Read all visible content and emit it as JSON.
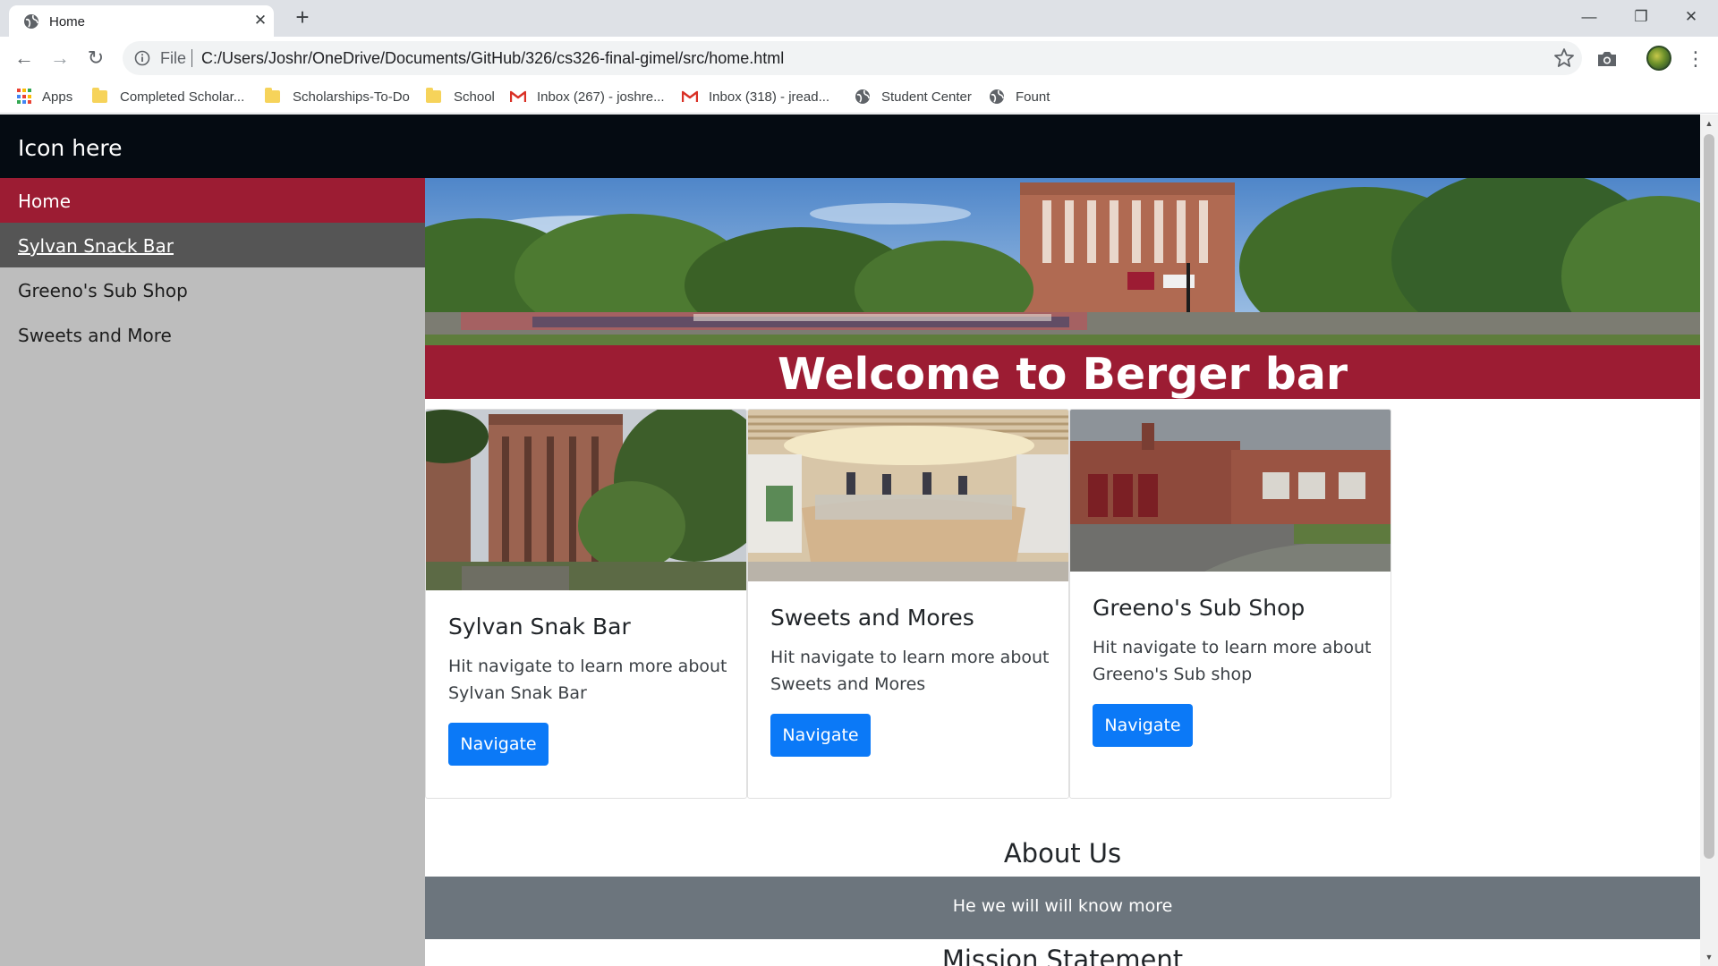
{
  "browser": {
    "tab_title": "Home",
    "tab_close": "✕",
    "new_tab": "+",
    "window_controls": {
      "minimize": "—",
      "restore": "❐",
      "close": "✕"
    },
    "nav": {
      "back": "←",
      "forward": "→",
      "reload": "↻"
    },
    "scheme_label": "File",
    "url": "C:/Users/Joshr/OneDrive/Documents/GitHub/326/cs326-final-gimel/src/home.html",
    "menu_dots": "⋮",
    "bookmarks": [
      {
        "label": "Apps",
        "icon": "apps-grid-icon"
      },
      {
        "label": "Completed Scholar...",
        "icon": "folder-icon"
      },
      {
        "label": "Scholarships-To-Do",
        "icon": "folder-icon"
      },
      {
        "label": "School",
        "icon": "folder-icon"
      },
      {
        "label": "Inbox (267) - joshre...",
        "icon": "gmail-icon"
      },
      {
        "label": "Inbox (318) - jread...",
        "icon": "gmail-icon"
      },
      {
        "label": "Student Center",
        "icon": "globe-icon"
      },
      {
        "label": "Fount",
        "icon": "globe-icon"
      }
    ]
  },
  "site": {
    "brand": "Icon here",
    "sidebar": [
      {
        "label": "Home",
        "state": "active"
      },
      {
        "label": "Sylvan Snack Bar",
        "state": "hover"
      },
      {
        "label": "Greeno's Sub Shop",
        "state": "normal"
      },
      {
        "label": "Sweets and More",
        "state": "normal"
      }
    ],
    "welcome": "Welcome to Berger bar",
    "cards": [
      {
        "title": "Sylvan Snak Bar",
        "text": "Hit navigate to learn more about Sylvan Snak Bar",
        "button": "Navigate"
      },
      {
        "title": "Sweets and Mores",
        "text": "Hit navigate to learn more about Sweets and Mores",
        "button": "Navigate"
      },
      {
        "title": "Greeno's Sub Shop",
        "text": "Hit navigate to learn more about Greeno's Sub shop",
        "button": "Navigate"
      }
    ],
    "about_title": "About Us",
    "about_text": "He we will will know more",
    "mission_title": "Mission Statement"
  },
  "colors": {
    "nav_dark": "#050b12",
    "maroon": "#9c1c33",
    "sidebar_bg": "#bdbdbd",
    "sidebar_hover": "#555555",
    "button_blue": "#0b79f7",
    "about_band": "#6c757d"
  }
}
